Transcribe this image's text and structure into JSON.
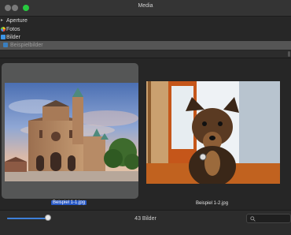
{
  "window": {
    "title": "Media"
  },
  "sidebar": {
    "items": [
      {
        "label": "Aperture",
        "icon": "chevron-right-icon"
      },
      {
        "label": "Fotos",
        "icon": "photos-app-icon"
      },
      {
        "label": "Bilder",
        "icon": "folder-icon"
      },
      {
        "label": "Beispielbilder",
        "icon": "folder-icon"
      }
    ]
  },
  "gallery": {
    "items": [
      {
        "caption": "Beispiel 1-1.jpg",
        "selected": true,
        "image": "cathedral-photo"
      },
      {
        "caption": "Beispiel 1-2.jpg",
        "selected": false,
        "image": "dog-photo"
      }
    ]
  },
  "status": {
    "count": "43 Bilder",
    "thumbnail_size": 0.95,
    "search_placeholder": ""
  },
  "colors": {
    "selection": "#2859c6",
    "accent": "#3d7fd9",
    "close_button": "#27c93f"
  }
}
